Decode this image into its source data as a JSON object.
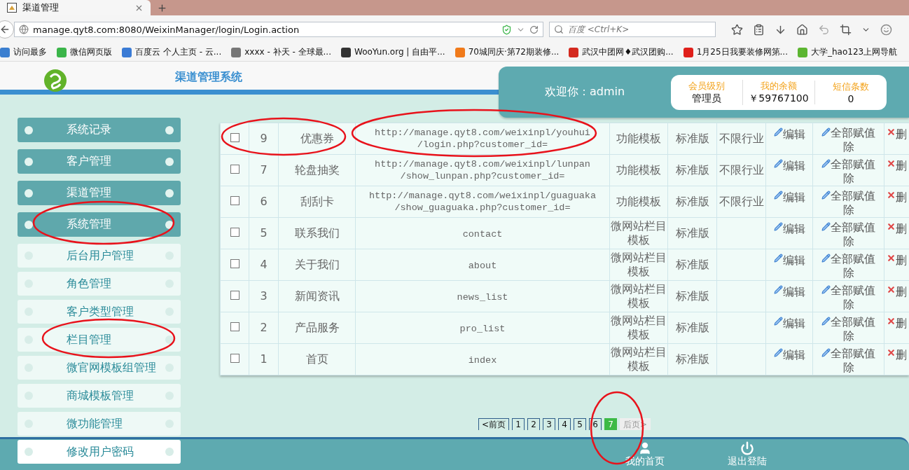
{
  "browser": {
    "tab_title": "渠道管理",
    "url": "manage.qyt8.com:8080/WeixinManager/login/Login.action",
    "search": {
      "placeholder": "百度 <Ctrl+K>"
    },
    "bookmarks": [
      {
        "label": "访问最多",
        "color": "#3b7fd0"
      },
      {
        "label": "微信网页版",
        "color": "#3bb54a"
      },
      {
        "label": "百度云 个人主页 - 云...",
        "color": "#3a7bd5"
      },
      {
        "label": "xxxx - 补天 - 全球最...",
        "color": "#777777"
      },
      {
        "label": "WooYun.org | 自由平...",
        "color": "#333333"
      },
      {
        "label": "70城同庆·第72期装修...",
        "color": "#f07a1a"
      },
      {
        "label": "武汉中团网♦武汉团购...",
        "color": "#d42a1f"
      },
      {
        "label": "1月25日我要装修网第...",
        "color": "#e0201b"
      },
      {
        "label": "大学_hao123上网导航",
        "color": "#5cb531"
      }
    ]
  },
  "header": {
    "system_title": "渠道管理系统",
    "welcome": "欢迎你：admin",
    "stats": [
      {
        "label": "会员级别",
        "value": "管理员"
      },
      {
        "label": "我的余额",
        "value": "￥59767100"
      },
      {
        "label": "短信条数",
        "value": "0"
      }
    ]
  },
  "sidebar": {
    "items": [
      {
        "label": "系统记录",
        "kind": "main"
      },
      {
        "label": "客户管理",
        "kind": "main"
      },
      {
        "label": "渠道管理",
        "kind": "main"
      },
      {
        "label": "系统管理",
        "kind": "main"
      },
      {
        "label": "后台用户管理",
        "kind": "sub"
      },
      {
        "label": "角色管理",
        "kind": "sub"
      },
      {
        "label": "客户类型管理",
        "kind": "sub"
      },
      {
        "label": "栏目管理",
        "kind": "sub"
      },
      {
        "label": "微官网模板组管理",
        "kind": "sub"
      },
      {
        "label": "商城模板管理",
        "kind": "sub"
      },
      {
        "label": "微功能管理",
        "kind": "sub"
      },
      {
        "label": "修改用户密码",
        "kind": "sub"
      }
    ]
  },
  "table": {
    "rows": [
      {
        "checked": false,
        "id": "9",
        "name": "优惠券",
        "url": "http://manage.qyt8.com/weixinpl/youhui/login.php?customer_id=",
        "type": "功能模板",
        "version": "标准版",
        "industry": "不限行业",
        "edit": "编辑",
        "assign": "全部赋值除",
        "delete": "删"
      },
      {
        "checked": false,
        "id": "7",
        "name": "轮盘抽奖",
        "url": "http://manage.qyt8.com/weixinpl/lunpan/show_lunpan.php?customer_id=",
        "type": "功能模板",
        "version": "标准版",
        "industry": "不限行业",
        "edit": "编辑",
        "assign": "全部赋值除",
        "delete": "删"
      },
      {
        "checked": false,
        "id": "6",
        "name": "刮刮卡",
        "url": "http://manage.qyt8.com/weixinpl/guaguaka/show_guaguaka.php?customer_id=",
        "type": "功能模板",
        "version": "标准版",
        "industry": "不限行业",
        "edit": "编辑",
        "assign": "全部赋值除",
        "delete": "删"
      },
      {
        "checked": false,
        "id": "5",
        "name": "联系我们",
        "url": "contact",
        "type": "微网站栏目模板",
        "version": "标准版",
        "edit": "编辑",
        "assign": "全部赋值除",
        "delete": "删"
      },
      {
        "checked": false,
        "id": "4",
        "name": "关于我们",
        "url": "about",
        "type": "微网站栏目模板",
        "version": "标准版",
        "edit": "编辑",
        "assign": "全部赋值除",
        "delete": "删"
      },
      {
        "checked": false,
        "id": "3",
        "name": "新闻资讯",
        "url": "news_list",
        "type": "微网站栏目模板",
        "version": "标准版",
        "edit": "编辑",
        "assign": "全部赋值除",
        "delete": "删"
      },
      {
        "checked": false,
        "id": "2",
        "name": "产品服务",
        "url": "pro_list",
        "type": "微网站栏目模板",
        "version": "标准版",
        "edit": "编辑",
        "assign": "全部赋值除",
        "delete": "删"
      },
      {
        "checked": false,
        "id": "1",
        "name": "首页",
        "url": "index",
        "type": "微网站栏目模板",
        "version": "标准版",
        "edit": "编辑",
        "assign": "全部赋值除",
        "delete": "删"
      }
    ]
  },
  "pagination": [
    {
      "label": "<前页",
      "selected": false,
      "disabled": false
    },
    {
      "label": "1",
      "selected": false,
      "disabled": false
    },
    {
      "label": "2",
      "selected": false,
      "disabled": false
    },
    {
      "label": "3",
      "selected": false,
      "disabled": false
    },
    {
      "label": "4",
      "selected": false,
      "disabled": false
    },
    {
      "label": "5",
      "selected": false,
      "disabled": false
    },
    {
      "label": "6",
      "selected": false,
      "disabled": false
    },
    {
      "label": "7",
      "selected": true,
      "disabled": false
    },
    {
      "label": "后页>",
      "selected": false,
      "disabled": true
    }
  ],
  "footer": {
    "items": [
      {
        "label": "我的首页",
        "kind": "user"
      },
      {
        "label": "退出登陆",
        "kind": "power"
      }
    ]
  }
}
